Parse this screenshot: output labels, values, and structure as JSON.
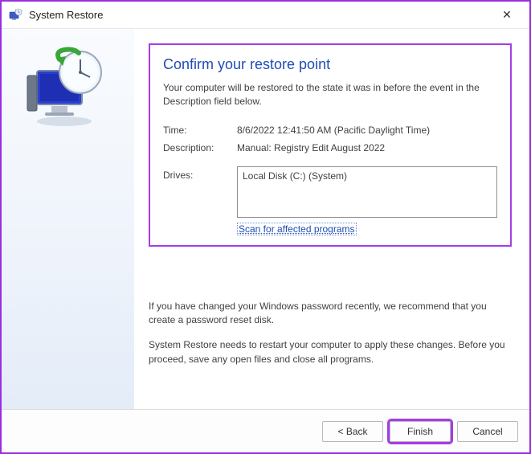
{
  "window": {
    "title": "System Restore"
  },
  "page": {
    "heading": "Confirm your restore point",
    "intro": "Your computer will be restored to the state it was in before the event in the Description field below.",
    "time_label": "Time:",
    "time_value": "8/6/2022 12:41:50 AM (Pacific Daylight Time)",
    "desc_label": "Description:",
    "desc_value": "Manual: Registry Edit August 2022",
    "drives_label": "Drives:",
    "drives_value": "Local Disk (C:) (System)",
    "scan_link": "Scan for affected programs",
    "note_password": "If you have changed your Windows password recently, we recommend that you create a password reset disk.",
    "note_restart": "System Restore needs to restart your computer to apply these changes. Before you proceed, save any open files and close all programs."
  },
  "buttons": {
    "back": "< Back",
    "finish": "Finish",
    "cancel": "Cancel"
  }
}
